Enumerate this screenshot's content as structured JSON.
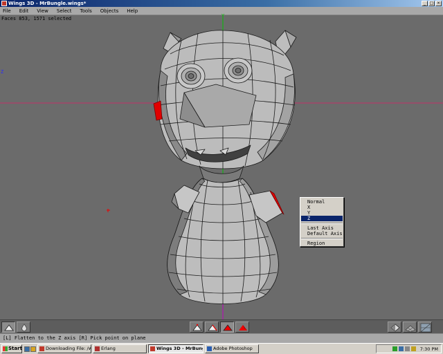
{
  "window": {
    "title": "Wings 3D - MrBungle.wings*",
    "min": "_",
    "max": "□",
    "close": "×"
  },
  "menu": [
    "File",
    "Edit",
    "View",
    "Select",
    "Tools",
    "Objects",
    "Help"
  ],
  "info": "Faces 853, 1571 selected",
  "axis_labels": {
    "y": "Y",
    "z": "Z"
  },
  "popup": {
    "items": [
      "Normal",
      "X",
      "Y",
      "Z",
      "Last Axis",
      "Default Axis",
      "Region"
    ],
    "selected": "Z"
  },
  "status": "[L] Flatten to the Z axis  [R] Pick point on plane",
  "taskbar": {
    "start": "Start",
    "tasks": [
      "Downloading File: /wings/...",
      "Erlang",
      "Wings 3D - MrBungle....",
      "Adobe Photoshop"
    ],
    "active_task": "Wings 3D - MrBungle....",
    "clock": "7:30 PM"
  },
  "colors": {
    "viewport_bg": "#6b6b6b",
    "x_axis": "#c0306a",
    "y_axis": "#00c000",
    "selection_blue": "#0a246a",
    "selected_face_red": "#e00000"
  }
}
